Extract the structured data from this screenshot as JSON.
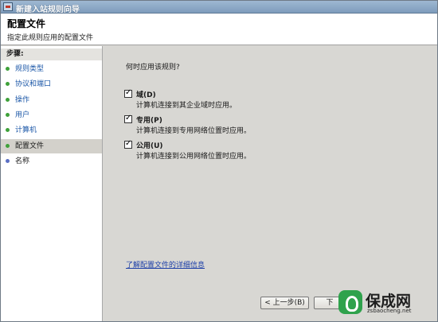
{
  "window": {
    "title": "新建入站规则向导"
  },
  "header": {
    "title": "配置文件",
    "subtitle": "指定此规则应用的配置文件"
  },
  "sidebar": {
    "steps_label": "步骤:",
    "items": [
      {
        "label": "规则类型",
        "state": "done"
      },
      {
        "label": "协议和端口",
        "state": "done"
      },
      {
        "label": "操作",
        "state": "done"
      },
      {
        "label": "用户",
        "state": "done"
      },
      {
        "label": "计算机",
        "state": "done"
      },
      {
        "label": "配置文件",
        "state": "current"
      },
      {
        "label": "名称",
        "state": "pending"
      }
    ]
  },
  "main": {
    "question": "何时应用该规则?",
    "options": [
      {
        "label": "域(D)",
        "description": "计算机连接到其企业域时应用。",
        "checked": true
      },
      {
        "label": "专用(P)",
        "description": "计算机连接到专用网络位置时应用。",
        "checked": true
      },
      {
        "label": "公用(U)",
        "description": "计算机连接到公用网络位置时应用。",
        "checked": true
      }
    ],
    "link": "了解配置文件的详细信息"
  },
  "buttons": {
    "back": "< 上一步(B)",
    "next": "下"
  },
  "watermark": {
    "brand": "保成网",
    "url": "zsbaocheng.net"
  },
  "colors": {
    "done_dot": "#3ea13a",
    "pending_dot": "#5a6fc4",
    "link": "#1d3fa8",
    "title_bar": "#8aa8c6"
  }
}
